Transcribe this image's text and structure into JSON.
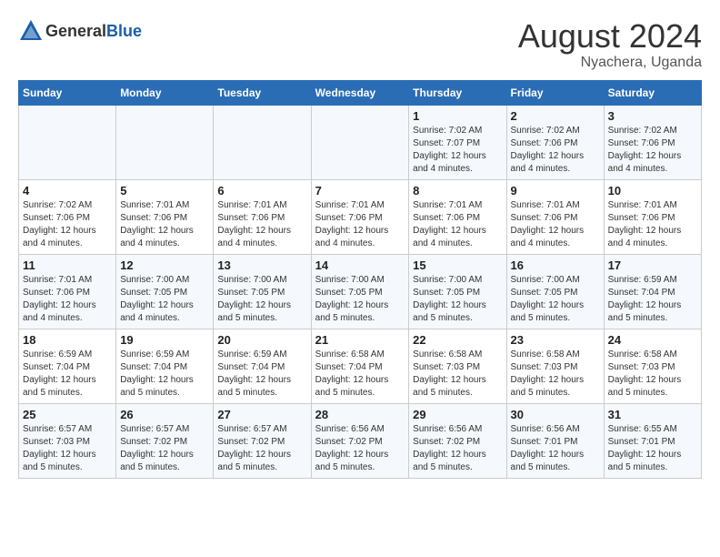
{
  "header": {
    "logo_general": "General",
    "logo_blue": "Blue",
    "month_title": "August 2024",
    "location": "Nyachera, Uganda"
  },
  "weekdays": [
    "Sunday",
    "Monday",
    "Tuesday",
    "Wednesday",
    "Thursday",
    "Friday",
    "Saturday"
  ],
  "weeks": [
    [
      {
        "day": "",
        "info": ""
      },
      {
        "day": "",
        "info": ""
      },
      {
        "day": "",
        "info": ""
      },
      {
        "day": "",
        "info": ""
      },
      {
        "day": "1",
        "info": "Sunrise: 7:02 AM\nSunset: 7:07 PM\nDaylight: 12 hours\nand 4 minutes."
      },
      {
        "day": "2",
        "info": "Sunrise: 7:02 AM\nSunset: 7:06 PM\nDaylight: 12 hours\nand 4 minutes."
      },
      {
        "day": "3",
        "info": "Sunrise: 7:02 AM\nSunset: 7:06 PM\nDaylight: 12 hours\nand 4 minutes."
      }
    ],
    [
      {
        "day": "4",
        "info": "Sunrise: 7:02 AM\nSunset: 7:06 PM\nDaylight: 12 hours\nand 4 minutes."
      },
      {
        "day": "5",
        "info": "Sunrise: 7:01 AM\nSunset: 7:06 PM\nDaylight: 12 hours\nand 4 minutes."
      },
      {
        "day": "6",
        "info": "Sunrise: 7:01 AM\nSunset: 7:06 PM\nDaylight: 12 hours\nand 4 minutes."
      },
      {
        "day": "7",
        "info": "Sunrise: 7:01 AM\nSunset: 7:06 PM\nDaylight: 12 hours\nand 4 minutes."
      },
      {
        "day": "8",
        "info": "Sunrise: 7:01 AM\nSunset: 7:06 PM\nDaylight: 12 hours\nand 4 minutes."
      },
      {
        "day": "9",
        "info": "Sunrise: 7:01 AM\nSunset: 7:06 PM\nDaylight: 12 hours\nand 4 minutes."
      },
      {
        "day": "10",
        "info": "Sunrise: 7:01 AM\nSunset: 7:06 PM\nDaylight: 12 hours\nand 4 minutes."
      }
    ],
    [
      {
        "day": "11",
        "info": "Sunrise: 7:01 AM\nSunset: 7:06 PM\nDaylight: 12 hours\nand 4 minutes."
      },
      {
        "day": "12",
        "info": "Sunrise: 7:00 AM\nSunset: 7:05 PM\nDaylight: 12 hours\nand 4 minutes."
      },
      {
        "day": "13",
        "info": "Sunrise: 7:00 AM\nSunset: 7:05 PM\nDaylight: 12 hours\nand 5 minutes."
      },
      {
        "day": "14",
        "info": "Sunrise: 7:00 AM\nSunset: 7:05 PM\nDaylight: 12 hours\nand 5 minutes."
      },
      {
        "day": "15",
        "info": "Sunrise: 7:00 AM\nSunset: 7:05 PM\nDaylight: 12 hours\nand 5 minutes."
      },
      {
        "day": "16",
        "info": "Sunrise: 7:00 AM\nSunset: 7:05 PM\nDaylight: 12 hours\nand 5 minutes."
      },
      {
        "day": "17",
        "info": "Sunrise: 6:59 AM\nSunset: 7:04 PM\nDaylight: 12 hours\nand 5 minutes."
      }
    ],
    [
      {
        "day": "18",
        "info": "Sunrise: 6:59 AM\nSunset: 7:04 PM\nDaylight: 12 hours\nand 5 minutes."
      },
      {
        "day": "19",
        "info": "Sunrise: 6:59 AM\nSunset: 7:04 PM\nDaylight: 12 hours\nand 5 minutes."
      },
      {
        "day": "20",
        "info": "Sunrise: 6:59 AM\nSunset: 7:04 PM\nDaylight: 12 hours\nand 5 minutes."
      },
      {
        "day": "21",
        "info": "Sunrise: 6:58 AM\nSunset: 7:04 PM\nDaylight: 12 hours\nand 5 minutes."
      },
      {
        "day": "22",
        "info": "Sunrise: 6:58 AM\nSunset: 7:03 PM\nDaylight: 12 hours\nand 5 minutes."
      },
      {
        "day": "23",
        "info": "Sunrise: 6:58 AM\nSunset: 7:03 PM\nDaylight: 12 hours\nand 5 minutes."
      },
      {
        "day": "24",
        "info": "Sunrise: 6:58 AM\nSunset: 7:03 PM\nDaylight: 12 hours\nand 5 minutes."
      }
    ],
    [
      {
        "day": "25",
        "info": "Sunrise: 6:57 AM\nSunset: 7:03 PM\nDaylight: 12 hours\nand 5 minutes."
      },
      {
        "day": "26",
        "info": "Sunrise: 6:57 AM\nSunset: 7:02 PM\nDaylight: 12 hours\nand 5 minutes."
      },
      {
        "day": "27",
        "info": "Sunrise: 6:57 AM\nSunset: 7:02 PM\nDaylight: 12 hours\nand 5 minutes."
      },
      {
        "day": "28",
        "info": "Sunrise: 6:56 AM\nSunset: 7:02 PM\nDaylight: 12 hours\nand 5 minutes."
      },
      {
        "day": "29",
        "info": "Sunrise: 6:56 AM\nSunset: 7:02 PM\nDaylight: 12 hours\nand 5 minutes."
      },
      {
        "day": "30",
        "info": "Sunrise: 6:56 AM\nSunset: 7:01 PM\nDaylight: 12 hours\nand 5 minutes."
      },
      {
        "day": "31",
        "info": "Sunrise: 6:55 AM\nSunset: 7:01 PM\nDaylight: 12 hours\nand 5 minutes."
      }
    ]
  ]
}
